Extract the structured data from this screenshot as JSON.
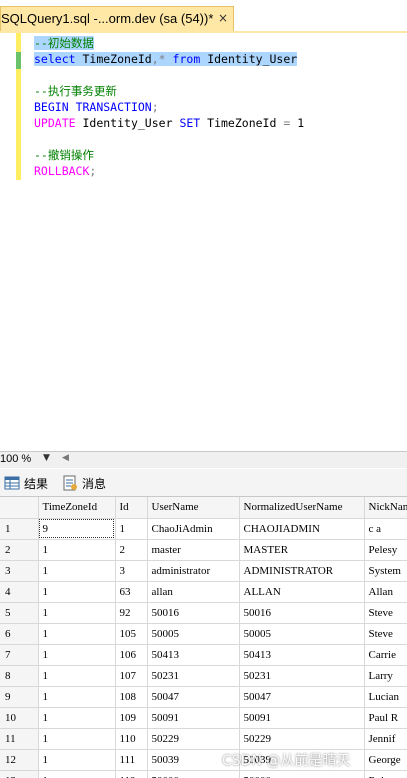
{
  "tab": {
    "title": "SQLQuery1.sql -...orm.dev (sa (54))*",
    "close": "×"
  },
  "editor": {
    "lines": [
      "--初始数据",
      "select TimeZoneId,* from Identity_User",
      "",
      "--执行事务更新",
      "BEGIN TRANSACTION;",
      "UPDATE Identity_User SET TimeZoneId = 1",
      "",
      "--撤销操作",
      "ROLLBACK;"
    ]
  },
  "status": {
    "zoom": "100 %"
  },
  "result_tabs": [
    {
      "label": "结果",
      "icon": "grid-icon"
    },
    {
      "label": "消息",
      "icon": "message-icon"
    }
  ],
  "grid": {
    "columns": [
      "TimeZoneId",
      "Id",
      "UserName",
      "NormalizedUserName",
      "NickName"
    ],
    "rows": [
      [
        "1",
        "9",
        "1",
        "ChaoJiAdmin",
        "CHAOJIADMIN",
        "c a"
      ],
      [
        "2",
        "1",
        "2",
        "master",
        "MASTER",
        "Pelesy"
      ],
      [
        "3",
        "1",
        "3",
        "administrator",
        "ADMINISTRATOR",
        "System"
      ],
      [
        "4",
        "1",
        "63",
        "allan",
        "ALLAN",
        "Allan"
      ],
      [
        "5",
        "1",
        "92",
        "50016",
        "50016",
        "Steve"
      ],
      [
        "6",
        "1",
        "105",
        "50005",
        "50005",
        "Steve"
      ],
      [
        "7",
        "1",
        "106",
        "50413",
        "50413",
        "Carrie"
      ],
      [
        "8",
        "1",
        "107",
        "50231",
        "50231",
        "Larry"
      ],
      [
        "9",
        "1",
        "108",
        "50047",
        "50047",
        "Lucian"
      ],
      [
        "10",
        "1",
        "109",
        "50091",
        "50091",
        "Paul R"
      ],
      [
        "11",
        "1",
        "110",
        "50229",
        "50229",
        "Jennif"
      ],
      [
        "12",
        "1",
        "111",
        "50039",
        "50039",
        "George"
      ],
      [
        "13",
        "1",
        "112",
        "50000",
        "50000",
        "Robert"
      ]
    ]
  },
  "watermark": "CSDN @从前是晴天"
}
